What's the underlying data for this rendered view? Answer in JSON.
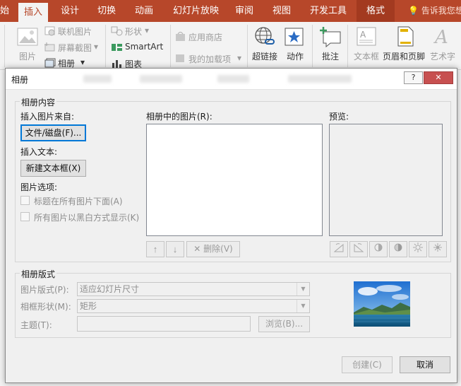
{
  "ribbon": {
    "tabs": [
      "始",
      "插入",
      "设计",
      "切换",
      "动画",
      "幻灯片放映",
      "审阅",
      "视图",
      "开发工具",
      "格式"
    ],
    "tell_me": "告诉我您想",
    "commands": {
      "pictures": "图片",
      "online_pictures": "联机图片",
      "screenshot": "屏幕截图",
      "album": "相册",
      "shapes": "形状",
      "smartart": "SmartArt",
      "chart": "图表",
      "store": "应用商店",
      "my_addins": "我的加载项",
      "hyperlink": "超链接",
      "action": "动作",
      "comment": "批注",
      "textbox": "文本框",
      "header_footer": "页眉和页脚",
      "wordart": "艺术字"
    },
    "accent": "#b7472a"
  },
  "dialog": {
    "title": "相册",
    "help_button": "?",
    "close_button": "✕",
    "content_group": "相册内容",
    "insert_from_label": "插入图片来自:",
    "file_disk_button": "文件/磁盘(F)...",
    "insert_text_label": "插入文本:",
    "new_textbox_button": "新建文本框(X)",
    "picture_options_label": "图片选项:",
    "option_captions": "标题在所有图片下面(A)",
    "option_blackwhite": "所有图片以黑白方式显示(K)",
    "pictures_in_album_label": "相册中的图片(R):",
    "preview_label": "预览:",
    "remove_button": "删除(V)",
    "layout_group": "相册版式",
    "picture_layout_label": "图片版式(P):",
    "picture_layout_value": "适应幻灯片尺寸",
    "frame_shape_label": "相框形状(M):",
    "frame_shape_value": "矩形",
    "theme_label": "主题(T):",
    "theme_value": "",
    "browse_button": "浏览(B)...",
    "create_button": "创建(C)",
    "cancel_button": "取消"
  }
}
